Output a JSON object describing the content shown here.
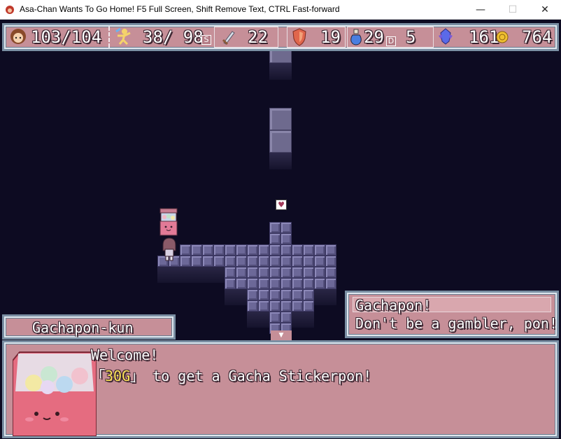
{
  "window": {
    "title": "Asa-Chan Wants To Go Home! F5 Full Screen, Shift Remove Text, CTRL Fast-forward",
    "minimize": "—",
    "maximize": "☐",
    "close": "✕"
  },
  "hud": {
    "hp": "103/104",
    "sp": "38/ 98",
    "sp_tag": "S",
    "attack": "22",
    "defense": "19",
    "potions": "29",
    "potion_tag": "D",
    "potion_extra": "5",
    "crystals": "161",
    "gold": "764",
    "icons": [
      "face-icon",
      "running-figure-icon",
      "sword-icon",
      "shield-icon",
      "potion-icon",
      "crystal-icon",
      "gold-coin-icon"
    ]
  },
  "dialogue": {
    "speaker": "Gachapon-kun",
    "speech_line1": "Gachapon!",
    "speech_line2": "Don't be a gambler, pon!",
    "message_line1": "Welcome!",
    "message_bracket_open": "「",
    "message_price": "30G",
    "message_bracket_close": "」",
    "message_rest": " to get a Gacha Stickerpon!"
  },
  "colors": {
    "window_pink": "#c68f98",
    "border_blue": "#7a8fa3",
    "background": "#0d0b22",
    "highlight_gold": "#ffe55a"
  }
}
